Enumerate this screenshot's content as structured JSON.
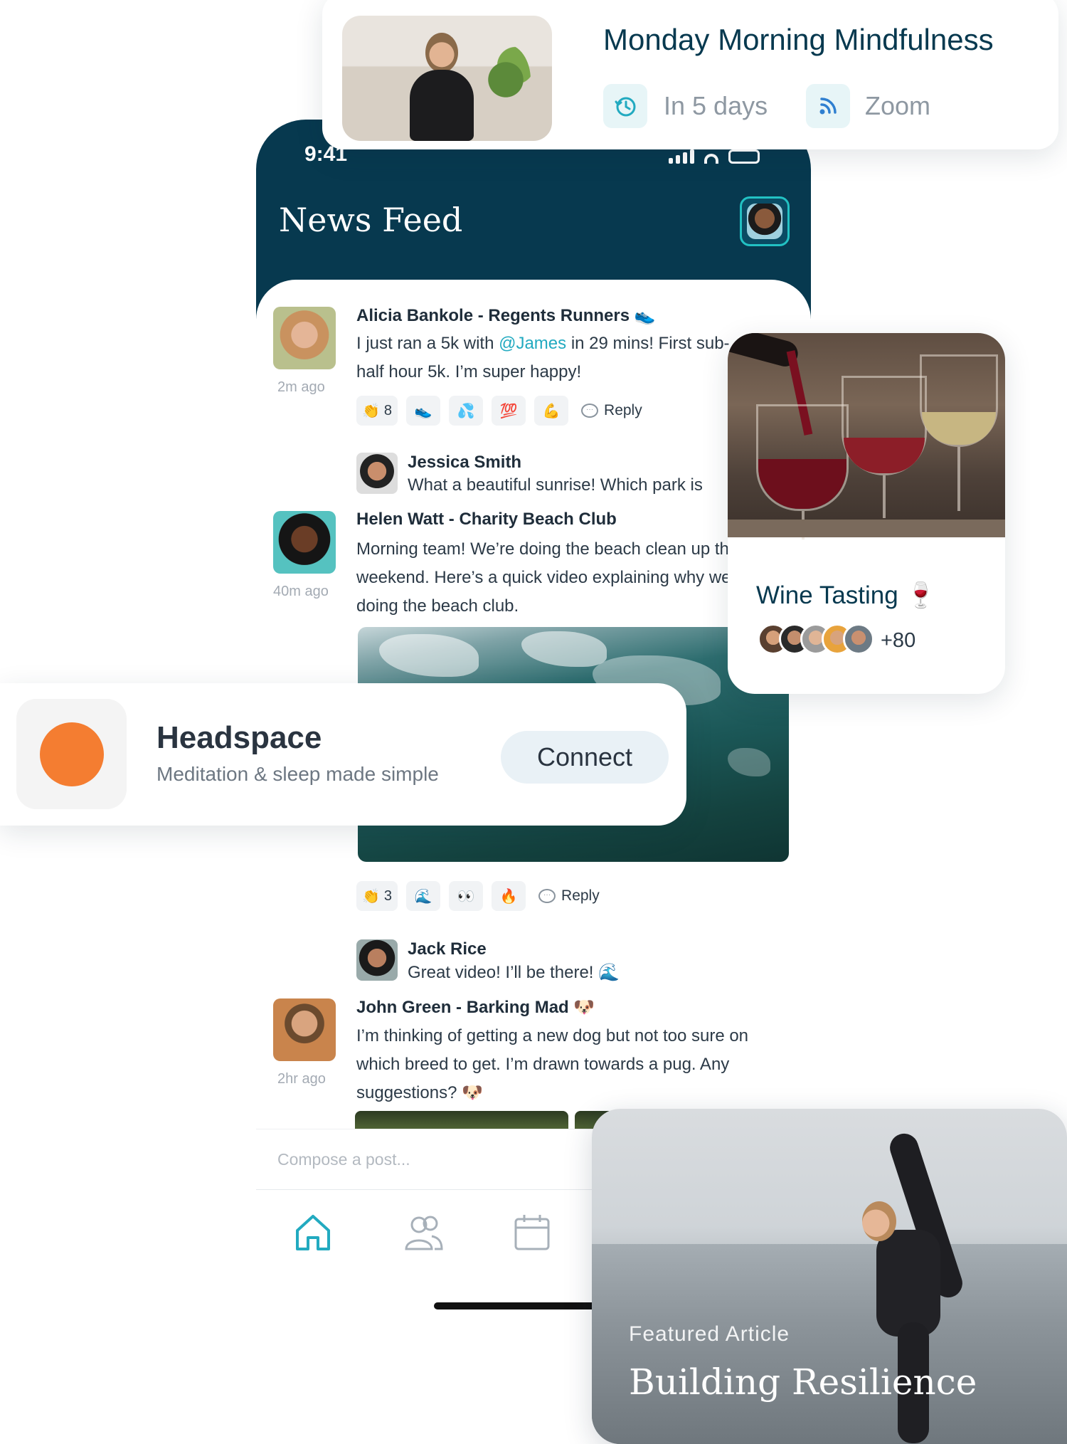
{
  "event_card": {
    "title": "Monday Morning Mindfulness",
    "when": "In 5 days",
    "platform": "Zoom",
    "when_icon": "clock-icon",
    "platform_icon": "broadcast-icon"
  },
  "status_bar": {
    "time": "9:41"
  },
  "news_feed": {
    "title": "News Feed",
    "posts": [
      {
        "author": "Alicia Bankole - Regents Runners 👟",
        "time": "2m ago",
        "text_before": "I just ran a 5k with ",
        "mention": "@James",
        "text_after": " in 29 mins! First sub-half hour 5k. I’m super happy!",
        "reactions": [
          {
            "emoji": "👏",
            "count": "8"
          },
          {
            "emoji": "👟",
            "count": ""
          },
          {
            "emoji": "💦",
            "count": ""
          },
          {
            "emoji": "💯",
            "count": ""
          },
          {
            "emoji": "💪",
            "count": ""
          }
        ],
        "reply_label": "Reply",
        "comment": {
          "name": "Jessica Smith",
          "text": "What a beautiful sunrise! Which park is"
        }
      },
      {
        "author": "Helen Watt - Charity Beach Club",
        "time": "40m ago",
        "text": "Morning team! We’re doing the beach clean up this weekend. Here’s a quick video explaining why we’re doing the beach club.",
        "reactions": [
          {
            "emoji": "👏",
            "count": "3"
          },
          {
            "emoji": "🌊",
            "count": ""
          },
          {
            "emoji": "👀",
            "count": ""
          },
          {
            "emoji": "🔥",
            "count": ""
          }
        ],
        "reply_label": "Reply",
        "comment": {
          "name": "Jack Rice",
          "text": "Great video! I’ll be there! 🌊"
        }
      },
      {
        "author": "John Green - Barking Mad 🐶",
        "time": "2hr ago",
        "text": "I’m thinking of getting a new dog but not too sure on which breed to get. I’m drawn towards a pug. Any suggestions? 🐶"
      }
    ],
    "compose_placeholder": "Compose a post...",
    "tabs": [
      "home-icon",
      "people-icon",
      "calendar-icon"
    ]
  },
  "wine_card": {
    "title": "Wine Tasting 🍷",
    "attendee_extra": "+80"
  },
  "headspace_card": {
    "name": "Headspace",
    "description": "Meditation & sleep made simple",
    "button": "Connect"
  },
  "article_card": {
    "kicker": "Featured Article",
    "title": "Building Resilience"
  },
  "colors": {
    "header_navy": "#07394f",
    "accent_teal": "#22aac0",
    "headspace_orange": "#f47d31"
  }
}
